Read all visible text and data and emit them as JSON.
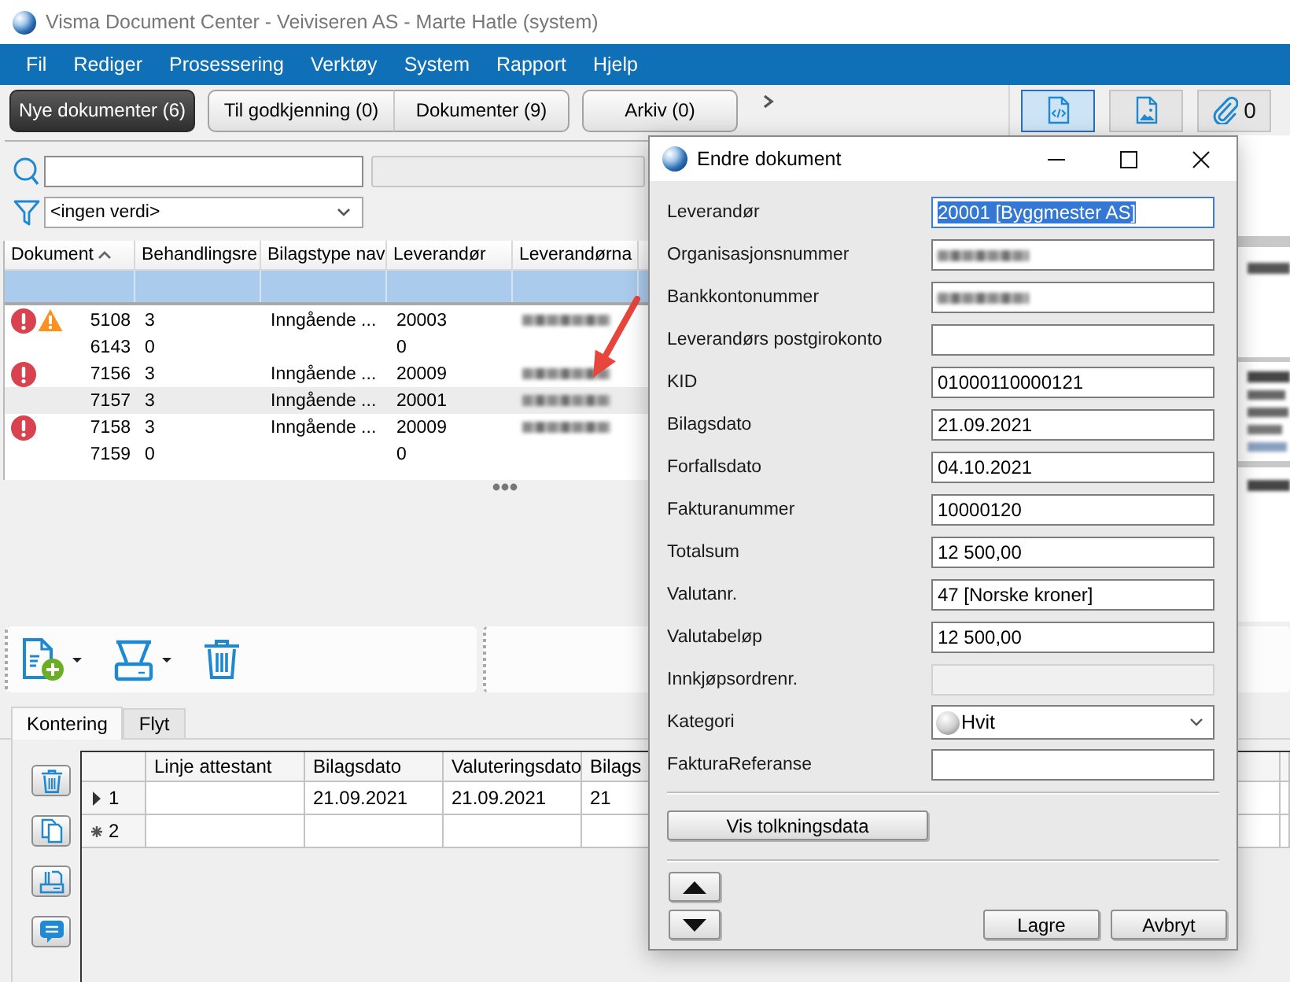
{
  "window": {
    "title": "Visma Document Center - Veiviseren AS - Marte Hatle (system)"
  },
  "menu": [
    "Fil",
    "Rediger",
    "Prosessering",
    "Verktøy",
    "System",
    "Rapport",
    "Hjelp"
  ],
  "view_tabs": [
    {
      "label": "Nye dokumenter (6)",
      "selected": true
    },
    {
      "label": "Til godkjenning (0)",
      "selected": false
    },
    {
      "label": "Dokumenter (9)",
      "selected": false
    },
    {
      "label": "Arkiv (0)",
      "selected": false
    }
  ],
  "preview_toolbar": {
    "view_buttons": [
      {
        "selected": true
      },
      {
        "selected": false
      }
    ],
    "attachment_count": "0"
  },
  "filter": {
    "value": "<ingen verdi>"
  },
  "documents": {
    "columns": [
      {
        "label": "Dokument",
        "sorted": true
      },
      {
        "label": "Behandlingsre",
        "sorted": false
      },
      {
        "label": "Bilagstype nav",
        "sorted": false
      },
      {
        "label": "Leverandør",
        "sorted": false
      },
      {
        "label": "Leverandørna",
        "sorted": false
      }
    ],
    "rows": [
      {
        "dokument": "5108",
        "error": true,
        "warning": true,
        "column_2": "3",
        "column_3": "Inngående ...",
        "leverandor": "20003",
        "column_5_blurred": true,
        "selected": false
      },
      {
        "dokument": "6143",
        "error": false,
        "warning": false,
        "column_2": "0",
        "leverandor": "0",
        "column_5_blurred": false,
        "selected": false
      },
      {
        "dokument": "7156",
        "error": true,
        "warning": false,
        "column_2": "3",
        "column_3": "Inngående ...",
        "leverandor": "20009",
        "column_5_blurred": true,
        "selected": false
      },
      {
        "dokument": "7157",
        "error": false,
        "warning": false,
        "column_2": "3",
        "column_3": "Inngående ...",
        "leverandor": "20001",
        "column_5_blurred": true,
        "selected": true
      },
      {
        "dokument": "7158",
        "error": true,
        "warning": false,
        "column_2": "3",
        "column_3": "Inngående ...",
        "leverandor": "20009",
        "column_5_blurred": true,
        "selected": false
      },
      {
        "dokument": "7159",
        "error": false,
        "warning": false,
        "column_2": "0",
        "leverandor": "0",
        "column_5_blurred": false,
        "selected": false
      }
    ]
  },
  "detail_tabs": [
    {
      "label": "Kontering",
      "selected": true
    },
    {
      "label": "Flyt",
      "selected": false
    }
  ],
  "posting_grid": {
    "columns": [
      "Linje attestant",
      "Bilagsdato",
      "Valuteringsdato",
      "Bilags"
    ],
    "rows": [
      {
        "number": "1",
        "current": true,
        "new": false,
        "cells": [
          null,
          "21.09.2021",
          "21.09.2021",
          "21"
        ]
      },
      {
        "number": "2",
        "current": false,
        "new": true
      }
    ]
  },
  "dialog": {
    "title": "Endre dokument",
    "fields": [
      {
        "kind": "text",
        "label": "Leverandør",
        "value": "20001 [Byggmester AS]",
        "focused": true,
        "disabled": false,
        "blurred": false
      },
      {
        "kind": "text",
        "label": "Organisasjonsnummer",
        "focused": false,
        "disabled": false,
        "blurred": true
      },
      {
        "kind": "text",
        "label": "Bankkontonummer",
        "focused": false,
        "disabled": false,
        "blurred": true
      },
      {
        "kind": "text",
        "label": "Leverandørs postgirokonto",
        "focused": false,
        "disabled": false,
        "blurred": false
      },
      {
        "kind": "text",
        "label": "KID",
        "value": "01000110000121",
        "focused": false,
        "disabled": false,
        "blurred": false
      },
      {
        "kind": "text",
        "label": "Bilagsdato",
        "value": "21.09.2021",
        "focused": false,
        "disabled": false,
        "blurred": false
      },
      {
        "kind": "text",
        "label": "Forfallsdato",
        "value": "04.10.2021",
        "focused": false,
        "disabled": false,
        "blurred": false
      },
      {
        "kind": "text",
        "label": "Fakturanummer",
        "value": "10000120",
        "focused": false,
        "disabled": false,
        "blurred": false
      },
      {
        "kind": "text",
        "label": "Totalsum",
        "value": "12 500,00",
        "focused": false,
        "disabled": false,
        "blurred": false
      },
      {
        "kind": "text",
        "label": "Valutanr.",
        "value": "47 [Norske kroner]",
        "focused": false,
        "disabled": false,
        "blurred": false
      },
      {
        "kind": "text",
        "label": "Valutabeløp",
        "value": "12 500,00",
        "focused": false,
        "disabled": false,
        "blurred": false
      },
      {
        "kind": "text",
        "label": "Innkjøpsordrenr.",
        "focused": false,
        "disabled": true,
        "blurred": false
      },
      {
        "kind": "combo",
        "label": "Kategori",
        "value": "Hvit",
        "focused": false,
        "disabled": false,
        "blurred": false
      },
      {
        "kind": "text",
        "label": "FakturaReferanse",
        "focused": false,
        "disabled": false,
        "blurred": false
      }
    ],
    "interpretation_button": "Vis tolkningsdata",
    "buttons": [
      "Lagre",
      "Avbryt"
    ]
  }
}
